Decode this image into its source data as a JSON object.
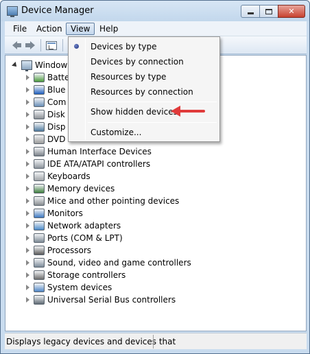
{
  "window": {
    "title": "Device Manager",
    "caption_buttons": {
      "close_glyph": "✕"
    }
  },
  "menubar": {
    "items": [
      "File",
      "Action",
      "View",
      "Help"
    ],
    "open_menu": "View"
  },
  "view_menu": {
    "items": [
      {
        "label": "Devices by type",
        "checked": true
      },
      {
        "label": "Devices by connection",
        "checked": false
      },
      {
        "label": "Resources by type",
        "checked": false
      },
      {
        "label": "Resources by connection",
        "checked": false
      },
      {
        "label": "Show hidden devices",
        "checked": false,
        "annotated": true
      },
      {
        "label": "Customize...",
        "checked": false
      }
    ]
  },
  "tree": {
    "root_label": "Window",
    "items": [
      {
        "label": "Batte",
        "icon": "battery-icon"
      },
      {
        "label": "Blue",
        "icon": "bluetooth-icon"
      },
      {
        "label": "Com",
        "icon": "computer-icon"
      },
      {
        "label": "Disk",
        "icon": "disk-drive-icon"
      },
      {
        "label": "Disp",
        "icon": "display-adapter-icon"
      },
      {
        "label": "DVD",
        "icon": "dvd-drive-icon"
      },
      {
        "label": "Human Interface Devices",
        "icon": "hid-icon"
      },
      {
        "label": "IDE ATA/ATAPI controllers",
        "icon": "ide-controller-icon"
      },
      {
        "label": "Keyboards",
        "icon": "keyboard-icon"
      },
      {
        "label": "Memory devices",
        "icon": "memory-icon"
      },
      {
        "label": "Mice and other pointing devices",
        "icon": "mouse-icon"
      },
      {
        "label": "Monitors",
        "icon": "monitor-icon"
      },
      {
        "label": "Network adapters",
        "icon": "network-adapter-icon"
      },
      {
        "label": "Ports (COM & LPT)",
        "icon": "port-icon"
      },
      {
        "label": "Processors",
        "icon": "processor-icon"
      },
      {
        "label": "Sound, video and game controllers",
        "icon": "sound-icon"
      },
      {
        "label": "Storage controllers",
        "icon": "storage-controller-icon"
      },
      {
        "label": "System devices",
        "icon": "system-device-icon"
      },
      {
        "label": "Universal Serial Bus controllers",
        "icon": "usb-icon"
      }
    ]
  },
  "statusbar": {
    "text": "Displays legacy devices and devices that"
  },
  "colors": {
    "annotation_arrow": "#e03a3a",
    "frame": "#c9dcef"
  }
}
